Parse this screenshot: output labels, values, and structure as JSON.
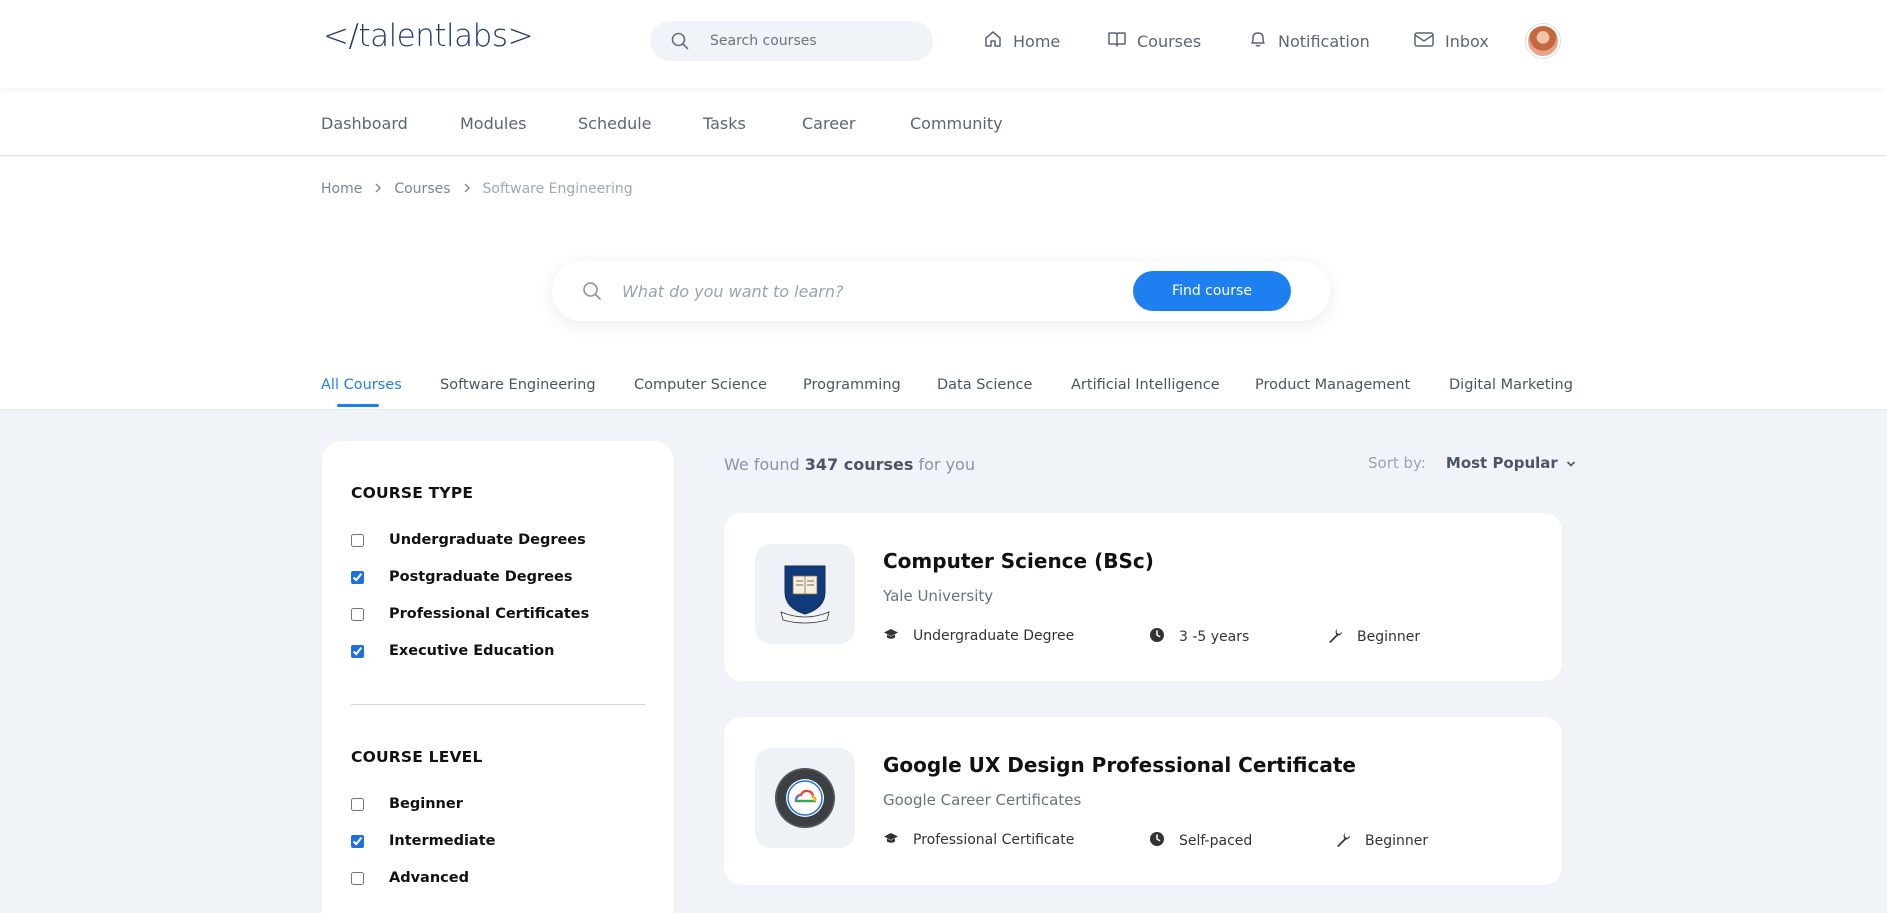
{
  "header": {
    "logo": "</talentlabs>",
    "search_placeholder": "Search courses",
    "nav": [
      {
        "label": "Home",
        "icon": "home-icon"
      },
      {
        "label": "Courses",
        "icon": "book-icon"
      },
      {
        "label": "Notification",
        "icon": "bell-icon"
      },
      {
        "label": "Inbox",
        "icon": "mail-icon"
      }
    ]
  },
  "subnav": [
    "Dashboard",
    "Modules",
    "Schedule",
    "Tasks",
    "Career",
    "Community"
  ],
  "breadcrumb": [
    "Home",
    "Courses",
    "Software Engineering"
  ],
  "hero": {
    "search_placeholder": "What do you want to learn?",
    "button_label": "Find course"
  },
  "tabs": [
    "All Courses",
    "Software Engineering",
    "Computer Science",
    "Programming",
    "Data Science",
    "Artificial Intelligence",
    "Product Management",
    "Digital Marketing"
  ],
  "filters": {
    "course_type_title": "COURSE TYPE",
    "course_type": [
      {
        "label": "Undergraduate Degrees",
        "checked": false
      },
      {
        "label": "Postgraduate Degrees",
        "checked": true
      },
      {
        "label": "Professional Certificates",
        "checked": false
      },
      {
        "label": "Executive Education",
        "checked": true
      }
    ],
    "course_level_title": "COURSE LEVEL",
    "course_level": [
      {
        "label": "Beginner",
        "checked": false
      },
      {
        "label": "Intermediate",
        "checked": true
      },
      {
        "label": "Advanced",
        "checked": false
      }
    ]
  },
  "results": {
    "prefix": "We found",
    "count": "347 courses",
    "suffix": "for you",
    "sort_label": "Sort by:",
    "sort_value": "Most Popular"
  },
  "courses": [
    {
      "title": "Computer Science (BSc)",
      "provider": "Yale University",
      "type": "Undergraduate Degree",
      "duration": "3 -5 years",
      "level": "Beginner",
      "logo": "yale-shield-logo"
    },
    {
      "title": "Google UX Design Professional Certificate",
      "provider": "Google Career Certificates",
      "type": "Professional Certificate",
      "duration": "Self-paced",
      "level": "Beginner",
      "logo": "google-cloud-badge-logo"
    }
  ],
  "colors": {
    "accent": "#1e80f0",
    "background": "#f0f4f8"
  }
}
